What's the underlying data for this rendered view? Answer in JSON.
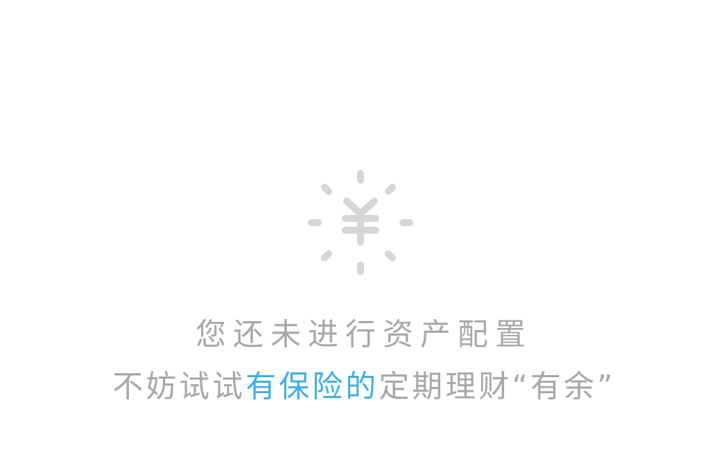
{
  "empty_state": {
    "icon": "yen-sunburst-icon",
    "icon_color": "#d6d6d6",
    "title": "您还未进行资产配置",
    "subtitle_prefix": "不妨试试",
    "subtitle_highlight": "有保险的",
    "subtitle_suffix": "定期理财“有余”",
    "text_color": "#a8a8a8",
    "highlight_color": "#3eaee6"
  }
}
